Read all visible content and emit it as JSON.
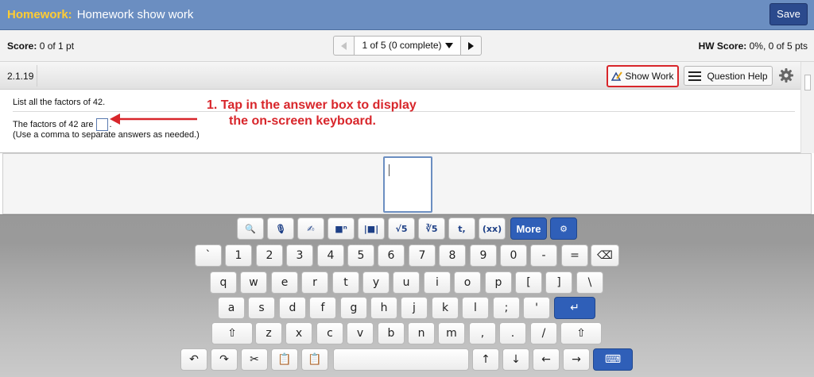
{
  "header": {
    "label": "Homework:",
    "title": "Homework show work",
    "save": "Save"
  },
  "scorebar": {
    "score_label": "Score:",
    "score_value": "0 of 1 pt",
    "pager_text": "1 of 5 (0 complete)",
    "hw_label": "HW Score:",
    "hw_value": "0%, 0 of 5 pts"
  },
  "question": {
    "number": "2.1.19",
    "show_work": "Show Work",
    "help": "Question Help",
    "prompt": "List all the factors of 42.",
    "answer_prefix": "The factors of 42 are",
    "answer_suffix": ".",
    "note": "(Use a comma to separate answers as needed.)"
  },
  "annotation": {
    "line1": "1. Tap in the answer box to display",
    "line2": "the on-screen keyboard.",
    "color": "#d8262b"
  },
  "keyboard": {
    "toolbar": [
      {
        "name": "math-search-key",
        "icon": "magnifier-icon",
        "label": "🔍"
      },
      {
        "name": "microphone-key",
        "icon": "microphone-icon",
        "label": "🎙"
      },
      {
        "name": "handwriting-key",
        "icon": "handwriting-icon",
        "label": "✍"
      },
      {
        "name": "superscript-key",
        "icon": "superscript-icon",
        "label": "■ⁿ"
      },
      {
        "name": "absolute-value-key",
        "icon": "absolute-value-icon",
        "label": "|■|"
      },
      {
        "name": "sqrt-key",
        "icon": "sqrt-icon",
        "label": "√5"
      },
      {
        "name": "nth-root-key",
        "icon": "nth-root-icon",
        "label": "∛5"
      },
      {
        "name": "text-key",
        "icon": "text-icon",
        "label": "t,"
      },
      {
        "name": "parentheses-key",
        "icon": "parentheses-icon",
        "label": "(xx)"
      },
      {
        "name": "more-key",
        "icon": "",
        "label": "More"
      },
      {
        "name": "keyboard-settings-key",
        "icon": "gear-icon",
        "label": "⚙"
      }
    ],
    "row1": [
      "`",
      "1",
      "2",
      "3",
      "4",
      "5",
      "6",
      "7",
      "8",
      "9",
      "0",
      "-",
      "=",
      "⌫"
    ],
    "row2": [
      "q",
      "w",
      "e",
      "r",
      "t",
      "y",
      "u",
      "i",
      "o",
      "p",
      "[",
      "]",
      "\\"
    ],
    "row3": [
      "a",
      "s",
      "d",
      "f",
      "g",
      "h",
      "j",
      "k",
      "l",
      ";",
      "'",
      "↵"
    ],
    "row4": [
      "⇧",
      "z",
      "x",
      "c",
      "v",
      "b",
      "n",
      "m",
      ",",
      ".",
      "/",
      "⇧"
    ],
    "row5": [
      "↶",
      "↷",
      "✂",
      "📋",
      "📋",
      "",
      "↑",
      "↓",
      "←",
      "→",
      "⌨"
    ],
    "accent": "#2f5fb8"
  }
}
